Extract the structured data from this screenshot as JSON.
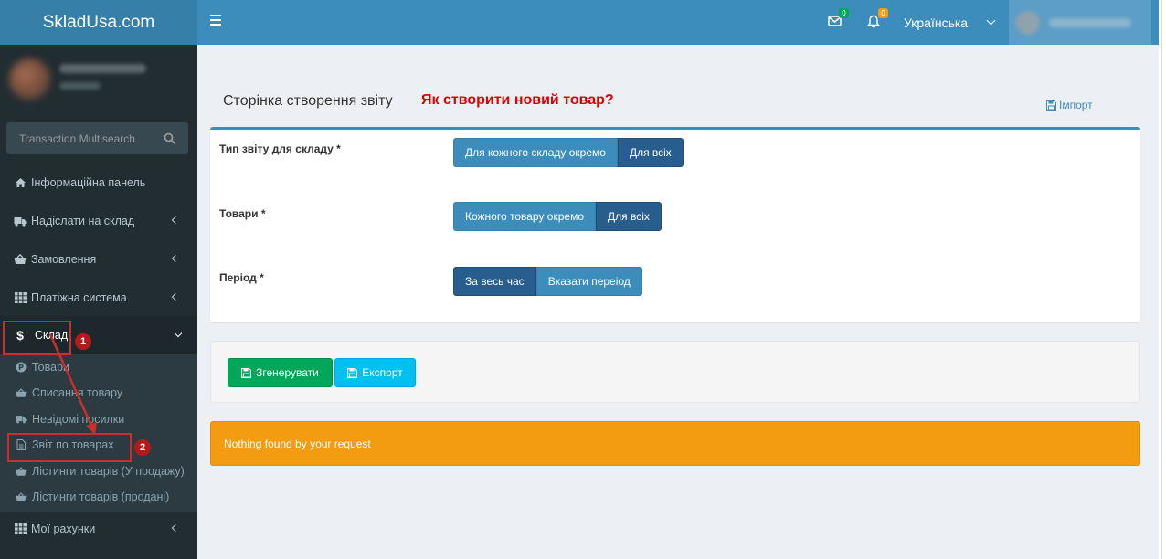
{
  "header": {
    "logo": "SkladUsa.com",
    "messages_count": "0",
    "notifications_count": "0",
    "language": "Українська"
  },
  "sidebar": {
    "search_placeholder": "Transaction Multisearch",
    "menu": [
      {
        "label": "Інформаційна панель",
        "icon": "home-icon"
      },
      {
        "label": "Надіслати на склад",
        "icon": "truck-icon"
      },
      {
        "label": "Замовлення",
        "icon": "basket-icon"
      },
      {
        "label": "Платіжна система",
        "icon": "grid-icon"
      },
      {
        "label": "Склад",
        "icon": "dollar-icon"
      },
      {
        "label": "Мої рахунки",
        "icon": "grid-icon"
      }
    ],
    "submenu": [
      {
        "label": "Товари",
        "icon": "product-circle-icon"
      },
      {
        "label": "Списання товару",
        "icon": "basket-icon"
      },
      {
        "label": "Невідомі посилки",
        "icon": "truck-icon"
      },
      {
        "label": "Звіт по товарах",
        "icon": "file-icon"
      },
      {
        "label": "Лістинги товарів (У продажу)",
        "icon": "basket-icon"
      },
      {
        "label": "Лістинги товарів (продані)",
        "icon": "basket-icon"
      }
    ]
  },
  "annotations": {
    "step1": "1",
    "step2": "2"
  },
  "main": {
    "title": "Сторінка створення звіту",
    "howto_link": "Як створити новий товар?",
    "import_label": "Імпорт",
    "form": {
      "warehouse_type": {
        "label": "Тип звіту для складу *",
        "options": [
          "Для кожного складу окремо",
          "Для всіх"
        ],
        "selected": "Для всіх"
      },
      "products": {
        "label": "Товари *",
        "options": [
          "Кожного товару окремо",
          "Для всіх"
        ],
        "selected": "Для всіх"
      },
      "period": {
        "label": "Період *",
        "options": [
          "За весь час",
          "Вказати переіод"
        ],
        "selected": "За весь час"
      }
    },
    "generate_label": "Згенерувати",
    "export_label": "Експорт",
    "alert_text": "Nothing found by your request"
  },
  "colors": {
    "header_bg": "#3c8dbc",
    "logo_bg": "#367fa9",
    "sidebar_bg": "#222d32",
    "alert_bg": "#f39c12",
    "generate_bg": "#00a65a",
    "export_bg": "#00c0ef",
    "annotation": "#c9302c",
    "howto_color": "#dd0000"
  }
}
